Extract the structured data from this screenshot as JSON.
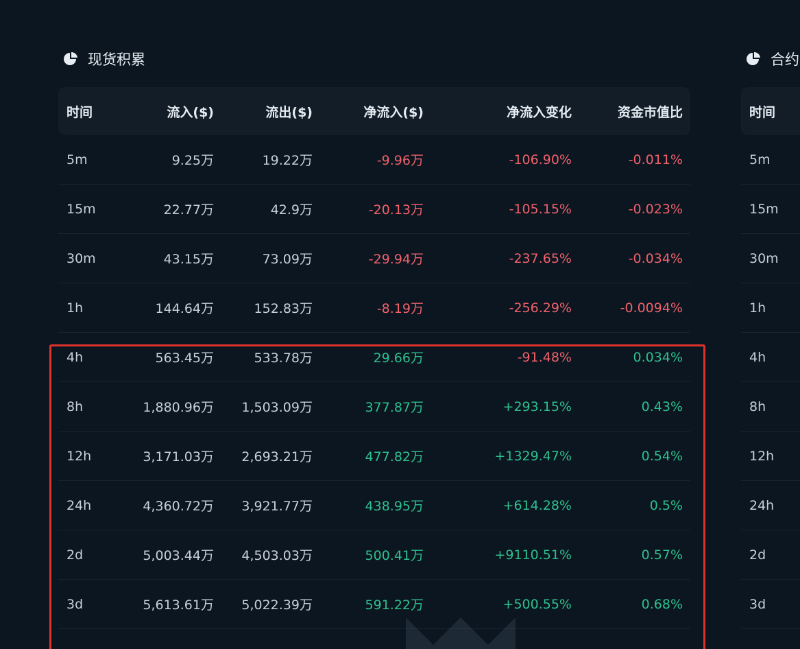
{
  "left_panel": {
    "title": "现货积累",
    "columns": [
      "时间",
      "流入($)",
      "流出($)",
      "净流入($)",
      "净流入变化",
      "资金市值比"
    ],
    "rows": [
      [
        "5m",
        "9.25万",
        "19.22万",
        "-9.96万",
        "-106.90%",
        "-0.011%"
      ],
      [
        "15m",
        "22.77万",
        "42.9万",
        "-20.13万",
        "-105.15%",
        "-0.023%"
      ],
      [
        "30m",
        "43.15万",
        "73.09万",
        "-29.94万",
        "-237.65%",
        "-0.034%"
      ],
      [
        "1h",
        "144.64万",
        "152.83万",
        "-8.19万",
        "-256.29%",
        "-0.0094%"
      ],
      [
        "4h",
        "563.45万",
        "533.78万",
        "29.66万",
        "-91.48%",
        "0.034%"
      ],
      [
        "8h",
        "1,880.96万",
        "1,503.09万",
        "377.87万",
        "+293.15%",
        "0.43%"
      ],
      [
        "12h",
        "3,171.03万",
        "2,693.21万",
        "477.82万",
        "+1329.47%",
        "0.54%"
      ],
      [
        "24h",
        "4,360.72万",
        "3,921.77万",
        "438.95万",
        "+614.28%",
        "0.5%"
      ],
      [
        "2d",
        "5,003.44万",
        "4,503.03万",
        "500.41万",
        "+9110.51%",
        "0.57%"
      ],
      [
        "3d",
        "5,613.61万",
        "5,022.39万",
        "591.22万",
        "+500.55%",
        "0.68%"
      ]
    ]
  },
  "right_panel": {
    "title": "合约",
    "columns": [
      "时间"
    ],
    "rows": [
      "5m",
      "15m",
      "30m",
      "1h",
      "4h",
      "8h",
      "12h",
      "24h",
      "2d",
      "3d"
    ]
  },
  "colors": {
    "background": "#0b1620",
    "header_bg": "#121d28",
    "negative": "#f0616b",
    "positive": "#2ec08e",
    "highlight_border": "#e0322d"
  },
  "icons": {
    "section": "pie-chart-icon"
  }
}
